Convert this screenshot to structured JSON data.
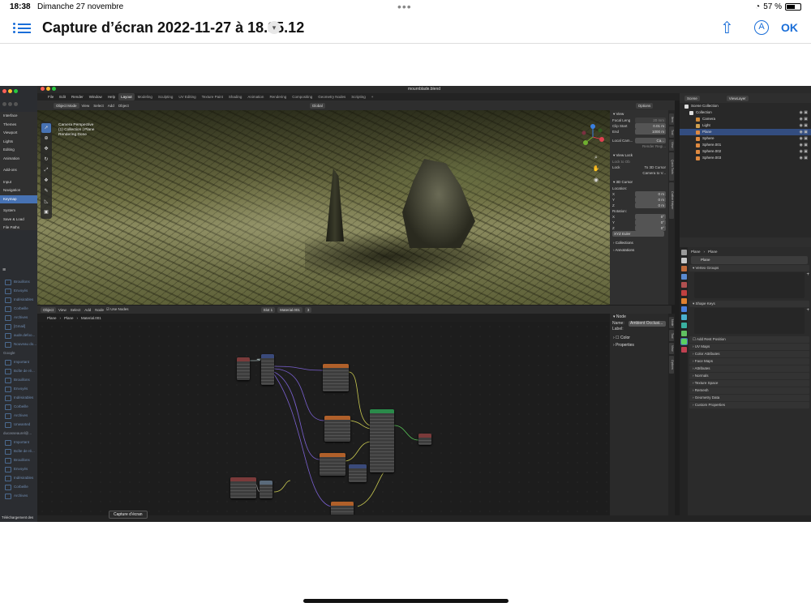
{
  "ipad": {
    "time": "18:38",
    "date": "Dimanche 27 novembre",
    "battery": "57 %",
    "title": "Capture d’écran 2022-11-27 à 18.35.12",
    "ok": "OK",
    "accent": "#1a6ed8"
  },
  "blender": {
    "file": "mournblade.blend",
    "menu": [
      "File",
      "Edit",
      "Render",
      "Window",
      "Help"
    ],
    "workspaces": [
      "Layout",
      "Modeling",
      "Sculpting",
      "UV Editing",
      "Texture Paint",
      "Shading",
      "Animation",
      "Rendering",
      "Compositing",
      "Geometry Nodes",
      "Scripting"
    ],
    "active_workspace": "Layout",
    "viewport_header": {
      "mode": "Object Mode",
      "menus": [
        "View",
        "Select",
        "Add",
        "Object"
      ],
      "transform": "Global",
      "options": "Options"
    },
    "viewport_info": [
      "Camera Perspective",
      "(1) Collection | Plane",
      "Rendering Done"
    ],
    "n_panel": {
      "view_title": "View",
      "focal_label": "Focal Leng",
      "focal_value": "20 mm",
      "clip_start_label": "Clip Start",
      "clip_start_value": "0.01 m",
      "end_label": "End",
      "end_value": "1000 m",
      "local_camera": "Local Cam...",
      "local_camera_value": "Ca...",
      "render_region": "Render Regi...",
      "view_lock": "View Lock",
      "lock_to_object": "Lock to Ob",
      "lock": "Lock",
      "to_3d_cursor": "To 3D Cursor",
      "camera_to_view": "Camera to V...",
      "cursor_title": "3D Cursor",
      "location": "Location:",
      "axes": [
        "X",
        "Y",
        "Z"
      ],
      "loc_values": [
        "0 m",
        "0 m",
        "0 m"
      ],
      "rotation": "Rotation:",
      "rot_values": [
        "0°",
        "0°",
        "0°"
      ],
      "rotation_mode": "XYZ Euler",
      "collections": "Collections",
      "annotations": "Annotations",
      "tabs": [
        "Item",
        "Tool",
        "View",
        "Quick Tools",
        "Outline Helper"
      ]
    },
    "node_header": {
      "type": "Object",
      "menus": [
        "View",
        "Select",
        "Add",
        "Node"
      ],
      "use_nodes": "Use Nodes",
      "slot": "Slot 1",
      "material": "Material.001",
      "users": "3"
    },
    "breadcrumb": [
      "Plane",
      "Plane",
      "Material.001"
    ],
    "node_side": {
      "title": "Node",
      "name_label": "Name:",
      "name_value": "Ambient Occlusi...",
      "label_label": "Label:",
      "color": "Color",
      "properties": "Properties",
      "tabs": [
        "Node",
        "Tool",
        "View",
        "Options"
      ]
    },
    "outliner": {
      "scene": "Scene",
      "view_layer": "ViewLayer",
      "rows": [
        "Scene Collection",
        "Collection",
        "Camera",
        "Light",
        "Plane",
        "Sphere",
        "Sphere.001",
        "Sphere.002",
        "Sphere.003"
      ]
    },
    "properties": {
      "object_path": [
        "Plane",
        "Plane"
      ],
      "mesh_name": "Plane",
      "sections": [
        "Vertex Groups",
        "Shape Keys",
        "Add Rest Position",
        "UV Maps",
        "Color Attributes",
        "Face Maps",
        "Attributes",
        "Normals",
        "Texture Space",
        "Remesh",
        "Geometry Data",
        "Custom Properties"
      ]
    },
    "prefs": [
      "Interface",
      "Themes",
      "Viewport",
      "Lights",
      "Editing",
      "Animation",
      "Add-ons",
      "Input",
      "Navigation",
      "Keymap",
      "System",
      "Save & Load",
      "File Paths"
    ],
    "prefs_selected": "Keymap",
    "mail": {
      "groups": [
        {
          "name": "",
          "items": [
            "Brouillons",
            "Envoyés",
            "Indésirables",
            "Corbeille",
            "Archives",
            "[Gmail]",
            "aude.defoo...",
            "Nouveau do..."
          ]
        },
        {
          "name": "Google",
          "items": [
            "Important",
            "Boîte de ré...",
            "Brouillons",
            "Envoyés",
            "Indésirables",
            "Corbeille",
            "Archives",
            "Unwanted"
          ]
        },
        {
          "name": "ducasseaurel@...",
          "items": [
            "Important",
            "Boîte de ré...",
            "Brouillons",
            "Envoyés",
            "Indésirables",
            "Corbeille",
            "Archives"
          ]
        }
      ],
      "footer": "Téléchargement des"
    },
    "tooltip": "Capture d’écran"
  }
}
